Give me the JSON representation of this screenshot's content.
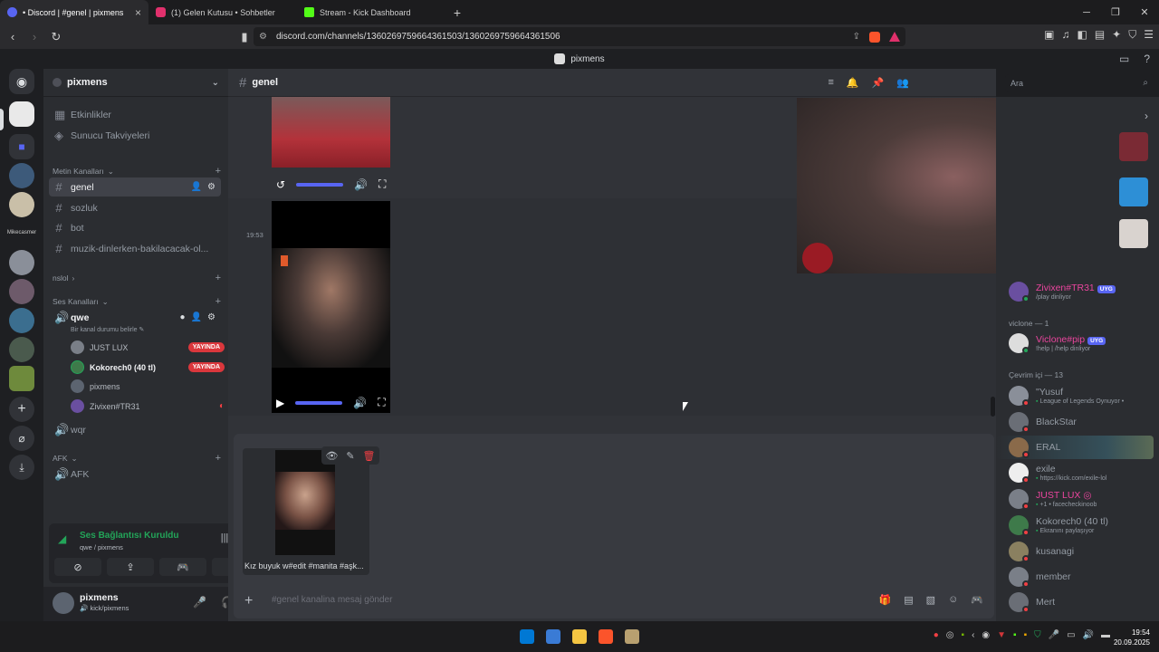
{
  "browser": {
    "tabs": [
      {
        "label": "• Discord | #genel | pixmens",
        "color": "#5865f2",
        "active": true
      },
      {
        "label": "(1) Gelen Kutusu • Sohbetler",
        "color": "#e1306c",
        "active": false
      },
      {
        "label": "Stream - Kick Dashboard",
        "color": "#53fc18",
        "active": false
      }
    ],
    "url": "discord.com/channels/1360269759664361503/1360269759664361506"
  },
  "discord": {
    "window_title": "pixmens",
    "server_name": "pixmens",
    "top_items": [
      "Etkinlikler",
      "Sunucu Takviyeleri"
    ],
    "text_category": "Metin Kanalları",
    "text_channels": [
      "genel",
      "sozluk",
      "bot",
      "muzik-dinlerken-bakilacacak-ol..."
    ],
    "category_nslol": "nslol",
    "voice_category": "Ses Kanalları",
    "voice_channel": "qwe",
    "voice_status": "Bir kanal durumu belirle",
    "voice_users": [
      {
        "name": "JUST LUX",
        "live": "YAYINDA"
      },
      {
        "name": "Kokorech0 (40 tl)",
        "live": "YAYINDA"
      },
      {
        "name": "pixmens",
        "live": ""
      },
      {
        "name": "Zivixen#TR31",
        "live": ""
      }
    ],
    "voice_channel_2": "wqr",
    "afk_category": "AFK",
    "afk_channel": "AFK",
    "rail_label": "Mikecasmer",
    "voice_panel": {
      "title": "Ses Bağlantısı Kuruldu",
      "sub": "qwe / pixmens"
    },
    "user": {
      "name": "pixmens",
      "sub": "kick/pixmens"
    },
    "channel_header": "genel",
    "search_placeholder": "Ara",
    "message_time": "19:53",
    "attachment_name": "Kız buyuk w#edit #manita #aşk...",
    "composer_placeholder": "#genel kanalina mesaj gönder",
    "members": {
      "top": [
        {
          "name": "Zivixen#TR31",
          "tag": "UYG",
          "sub": "/play dinliyor",
          "color": "#eb459e"
        }
      ],
      "cat_viclone": "viclone — 1",
      "viclone": [
        {
          "name": "Viclone#pip",
          "tag": "UYG",
          "sub": "!help | /help dinliyor",
          "color": "#eb459e"
        }
      ],
      "cat_online": "Çevrim içi — 13",
      "online": [
        {
          "name": "\"Yusuf",
          "sub": "League of Legends Oynuyor •",
          "color": "#949ba4"
        },
        {
          "name": "BlackStar",
          "sub": "",
          "color": "#949ba4"
        },
        {
          "name": "ERAL",
          "sub": "",
          "color": "#949ba4"
        },
        {
          "name": "exile",
          "sub": "https://kick.com/exile-lol",
          "color": "#949ba4"
        },
        {
          "name": "JUST LUX",
          "sub": "+1 • facecheckinoob",
          "color": "#eb459e"
        },
        {
          "name": "Kokorech0 (40 tl)",
          "sub": "Ekranını paylaşıyor",
          "color": "#949ba4"
        },
        {
          "name": "kusanagi",
          "sub": "",
          "color": "#949ba4"
        },
        {
          "name": "member",
          "sub": "",
          "color": "#949ba4"
        },
        {
          "name": "Mert",
          "sub": "",
          "color": "#949ba4"
        }
      ]
    }
  },
  "taskbar": {
    "time": "19:54",
    "date": "20.09.2025"
  }
}
